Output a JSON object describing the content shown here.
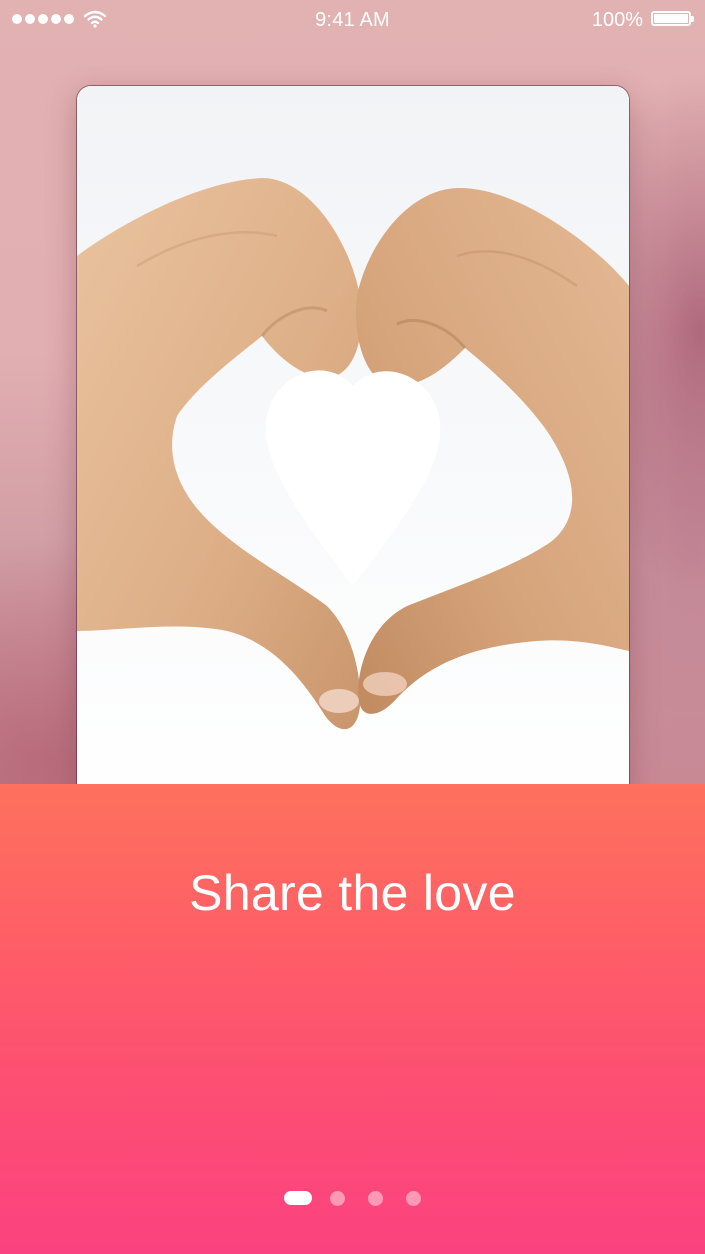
{
  "status_bar": {
    "time": "9:41 AM",
    "battery_percent": "100%",
    "signal_bars": 5,
    "battery_level": 1.0
  },
  "card": {
    "image_icon": "heart-hands-icon"
  },
  "onboarding": {
    "headline": "Share the love",
    "page_count": 4,
    "current_page": 1
  },
  "colors": {
    "panel_top": "#fe715d",
    "panel_bottom": "#fb4280",
    "background": "#dca9ad"
  }
}
